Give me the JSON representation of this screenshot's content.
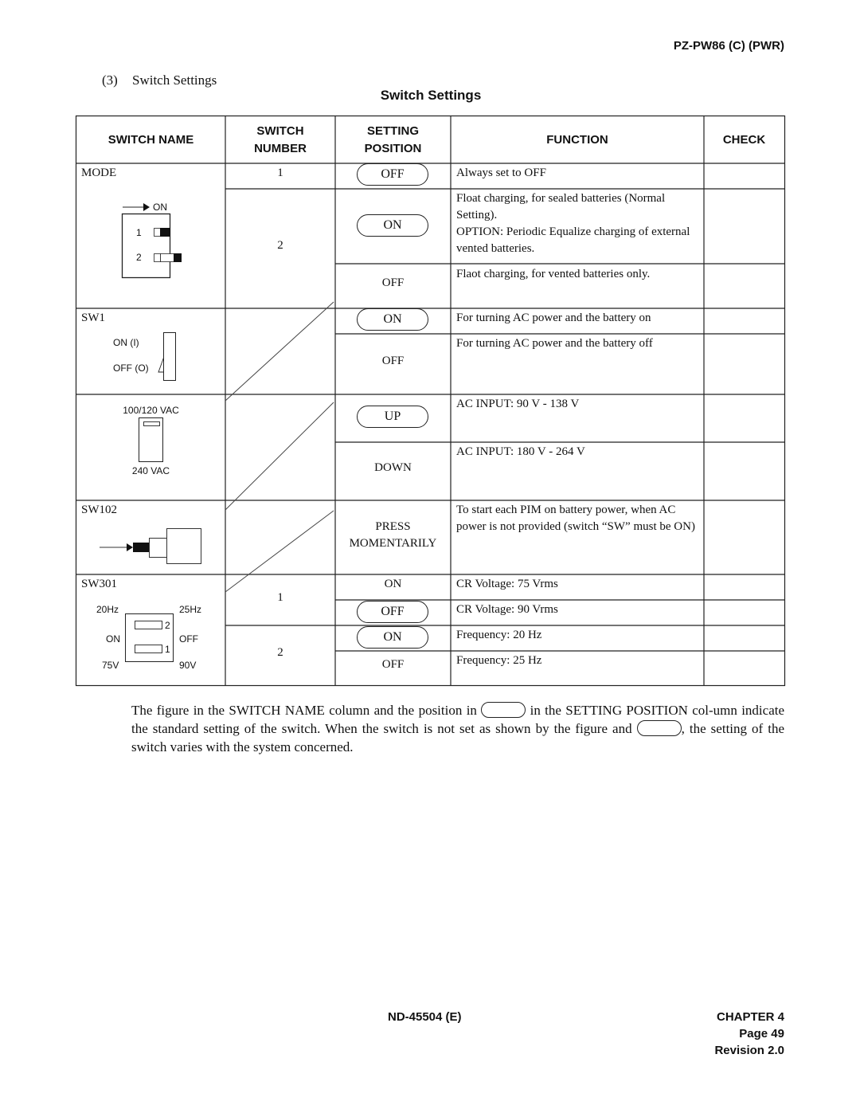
{
  "header": {
    "model": "PZ-PW86 (C) (PWR)"
  },
  "section": {
    "number": "(3)",
    "title": "Switch Settings"
  },
  "table": {
    "title": "Switch Settings",
    "columns": {
      "switch_name": "SWITCH NAME",
      "switch_number_l1": "SWITCH",
      "switch_number_l2": "NUMBER",
      "setting_position_l1": "SETTING",
      "setting_position_l2": "POSITION",
      "function": "FUNCTION",
      "check": "CHECK"
    },
    "groups": {
      "mode": {
        "name": "MODE",
        "figure": {
          "arrow_label": "ON",
          "switch_labels": [
            "1",
            "2"
          ]
        },
        "rows": [
          {
            "number": "1",
            "position": "OFF",
            "standard": true,
            "function": "Always set to OFF"
          },
          {
            "number": "2",
            "position": "ON",
            "standard": true,
            "function": "Float charging, for sealed batteries (Normal Setting).\nOPTION: Periodic Equalize charging of external vented batteries."
          },
          {
            "number": "",
            "position": "OFF",
            "standard": false,
            "function": "Flaot charging, for vented batteries only."
          }
        ]
      },
      "sw1": {
        "name": "SW1",
        "figure": {
          "on_label": "ON (I)",
          "off_label": "OFF (O)"
        },
        "rows": [
          {
            "position": "ON",
            "standard": true,
            "function": "For turning AC power and the battery on"
          },
          {
            "position": "OFF",
            "standard": false,
            "function": "For turning AC power and the battery off"
          }
        ]
      },
      "vac": {
        "name": "",
        "figure": {
          "top_label": "100/120 VAC",
          "bottom_label": "240 VAC"
        },
        "rows": [
          {
            "position": "UP",
            "standard": true,
            "function": "AC INPUT: 90 V - 138 V"
          },
          {
            "position": "DOWN",
            "standard": false,
            "function": "AC INPUT: 180 V - 264 V"
          }
        ]
      },
      "sw102": {
        "name": "SW102",
        "rows": [
          {
            "position_l1": "PRESS",
            "position_l2": "MOMENTARILY",
            "standard": false,
            "function": "To start each PIM on battery power, when AC power is not provided (switch “SW” must be ON)"
          }
        ]
      },
      "sw301": {
        "name": "SW301",
        "figure": {
          "tl": "20Hz",
          "tr": "25Hz",
          "ml": "ON",
          "mr": "OFF",
          "bl": "75V",
          "br": "90V",
          "lever_top": "2",
          "lever_bottom": "1"
        },
        "rows": [
          {
            "number": "1",
            "position": "ON",
            "standard": false,
            "function": "CR Voltage: 75 Vrms"
          },
          {
            "number": "",
            "position": "OFF",
            "standard": true,
            "function": "CR Voltage: 90 Vrms"
          },
          {
            "number": "2",
            "position": "ON",
            "standard": true,
            "function": "Frequency: 20 Hz"
          },
          {
            "number": "",
            "position": "OFF",
            "standard": false,
            "function": "Frequency: 25 Hz"
          }
        ]
      }
    }
  },
  "note": {
    "part1": "The figure in the SWITCH NAME column and the position in",
    "part2": "in the SETTING POSITION col-umn indicate the standard setting of the switch. When the switch is not set as shown by the figure and",
    "part3": ", the setting of the switch varies with the system concerned."
  },
  "footer": {
    "doc_number": "ND-45504 (E)",
    "chapter": "CHAPTER 4",
    "page": "Page 49",
    "revision": "Revision 2.0"
  }
}
